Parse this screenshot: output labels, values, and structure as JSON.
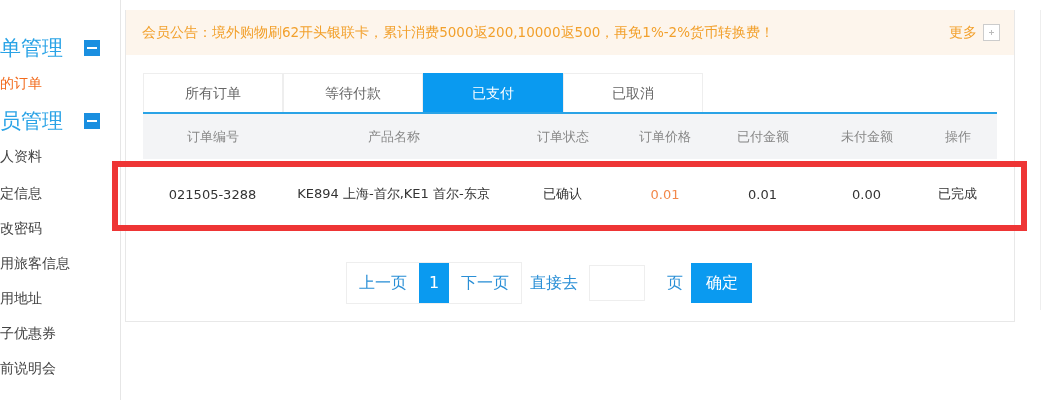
{
  "sidebar": {
    "sections": [
      {
        "title": "单管理",
        "expanded": true,
        "items": [
          {
            "label": "的订单",
            "selected": true
          }
        ]
      },
      {
        "title": "员管理",
        "expanded": true,
        "items": [
          {
            "label": "人资料",
            "selected": false
          },
          {
            "label": "定信息",
            "selected": false
          },
          {
            "label": "改密码",
            "selected": false
          },
          {
            "label": "用旅客信息",
            "selected": false
          },
          {
            "label": "用地址",
            "selected": false
          },
          {
            "label": "子优惠券",
            "selected": false
          },
          {
            "label": "前说明会",
            "selected": false
          }
        ]
      }
    ]
  },
  "notice": {
    "text": "会员公告：境外购物刷62开头银联卡，累计消费5000返200,10000返500，再免1%-2%货币转换费！",
    "more": "更多"
  },
  "tabs": [
    {
      "label": "所有订单",
      "selected": false
    },
    {
      "label": "等待付款",
      "selected": false
    },
    {
      "label": "已支付",
      "selected": true
    },
    {
      "label": "已取消",
      "selected": false
    }
  ],
  "table": {
    "columns": [
      "订单编号",
      "产品名称",
      "订单状态",
      "订单价格",
      "已付金额",
      "未付金额",
      "操作"
    ],
    "rows": [
      {
        "highlighted": true,
        "cells": [
          "021505-3288",
          "KE894 上海-首尔,KE1 首尔-东京",
          "已确认",
          "0.01",
          "0.01",
          "0.00",
          "已完成"
        ]
      }
    ]
  },
  "pagination": {
    "prev": "上一页",
    "pages": [
      {
        "label": "1",
        "selected": true
      }
    ],
    "next": "下一页",
    "goto_label": "直接去",
    "page_unit": "页",
    "confirm": "确定"
  }
}
